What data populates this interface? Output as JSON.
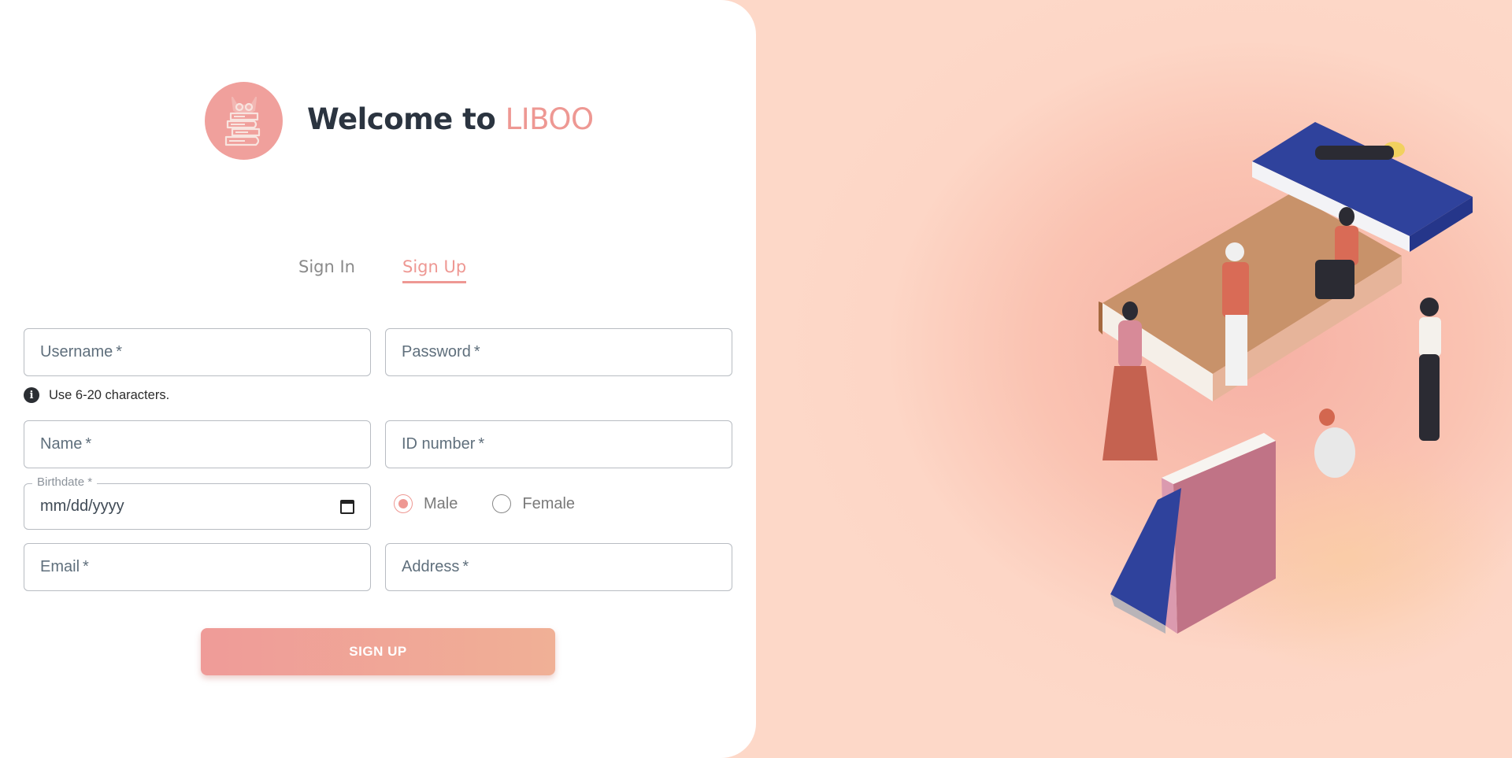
{
  "header": {
    "welcome_text": "Welcome to",
    "brand_name": "LIBOO"
  },
  "tabs": [
    {
      "label": "Sign In",
      "active": false
    },
    {
      "label": "Sign Up",
      "active": true
    }
  ],
  "form": {
    "username_label": "Username",
    "password_label": "Password",
    "required_mark": "*",
    "username_helper": "Use 6-20 characters.",
    "name_label": "Name",
    "id_number_label": "ID number",
    "birthdate_label": "Birthdate *",
    "birthdate_placeholder": "mm/dd/yyyy",
    "gender_options": [
      {
        "label": "Male",
        "selected": true
      },
      {
        "label": "Female",
        "selected": false
      }
    ],
    "email_label": "Email",
    "address_label": "Address",
    "submit_label": "SIGN UP"
  },
  "colors": {
    "brand_accent": "#ee9893",
    "right_background": "#fdd8c8",
    "text_dark": "#2b3440"
  },
  "icons": {
    "logo": "owl-on-books-logo",
    "helper": "info-circle-icon",
    "date": "calendar-icon",
    "illustration": "people-reading-on-giant-books"
  }
}
